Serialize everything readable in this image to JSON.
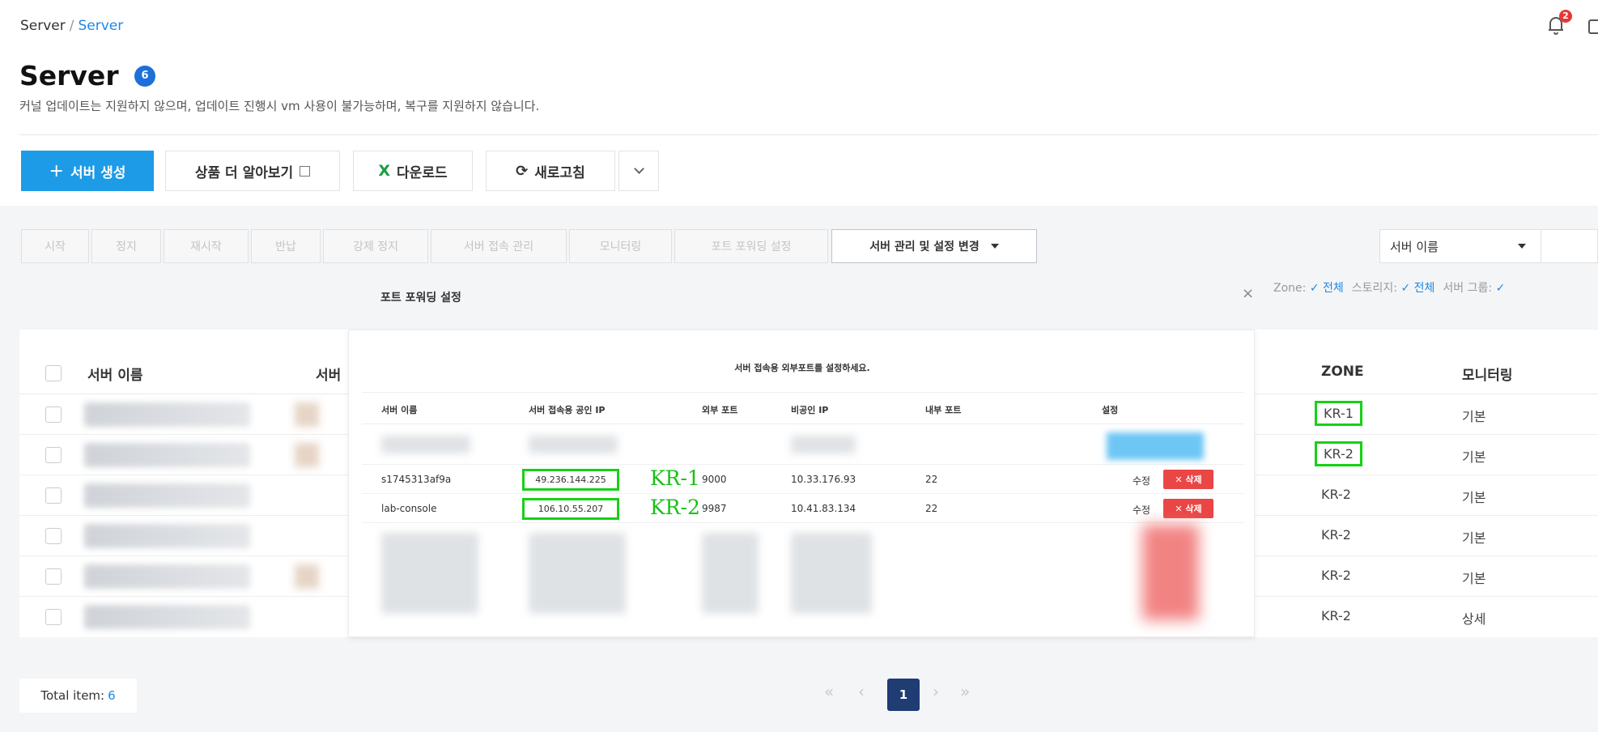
{
  "breadcrumb": {
    "root": "Server",
    "separator": "/",
    "current": "Server"
  },
  "header": {
    "title": "Server",
    "title_badge": "6",
    "notification_count": "2",
    "subtitle": "커널 업데이트는 지원하지 않으며, 업데이트 진행시 vm 사용이 불가능하며, 복구를 지원하지 않습니다."
  },
  "toolbar": {
    "create_label": "서버 생성",
    "learn_more_label": "상품 더 알아보기",
    "download_label": "다운로드",
    "refresh_label": "새로고침"
  },
  "actions": {
    "items": [
      "시작",
      "정지",
      "재시작",
      "반납",
      "강제 정지",
      "서버 접속 관리",
      "모니터링",
      "포트 포워딩 설정"
    ],
    "manage_label": "서버 관리 및 설정 변경"
  },
  "search": {
    "field_label": "서버 이름"
  },
  "filters": [
    {
      "label": "Zone:",
      "value": "전체"
    },
    {
      "label": "스토리지:",
      "value": "전체"
    },
    {
      "label": "서버 그룹:",
      "value": ""
    }
  ],
  "table": {
    "columns": {
      "name": "서버 이름",
      "col2": "서버",
      "zone": "ZONE",
      "monitoring": "모니터링"
    },
    "rows": [
      {
        "zone": "KR-1",
        "monitoring": "기본"
      },
      {
        "zone": "KR-2",
        "monitoring": "기본"
      },
      {
        "zone": "KR-2",
        "monitoring": "기본"
      },
      {
        "zone": "KR-2",
        "monitoring": "기본"
      },
      {
        "zone": "KR-2",
        "monitoring": "기본"
      },
      {
        "zone": "KR-2",
        "monitoring": "상세"
      }
    ]
  },
  "modal": {
    "title": "포트 포워딩 설정",
    "description": "서버 접속용 외부포트를 설정하세요.",
    "columns": {
      "name": "서버 이름",
      "public_ip": "서버 접속용 공인 IP",
      "external_port": "외부 포트",
      "private_ip": "비공인 IP",
      "internal_port": "내부 포트",
      "settings": "설정"
    },
    "rows": [
      {
        "name": "s1745313af9a",
        "public_ip": "49.236.144.225",
        "zone_tag": "KR-1",
        "external_port": "9000",
        "private_ip": "10.33.176.93",
        "internal_port": "22",
        "edit": "수정",
        "delete": "✕ 삭제"
      },
      {
        "name": "lab-console",
        "public_ip": "106.10.55.207",
        "zone_tag": "KR-2",
        "external_port": "9987",
        "private_ip": "10.41.83.134",
        "internal_port": "22",
        "edit": "수정",
        "delete": "✕ 삭제"
      }
    ]
  },
  "footer": {
    "total_label": "Total item:",
    "total_value": "6",
    "current_page": "1"
  },
  "colors": {
    "primary": "#1e9be6",
    "highlight": "#16d116",
    "danger": "#ea4646",
    "pager_active": "#1f3c73"
  }
}
